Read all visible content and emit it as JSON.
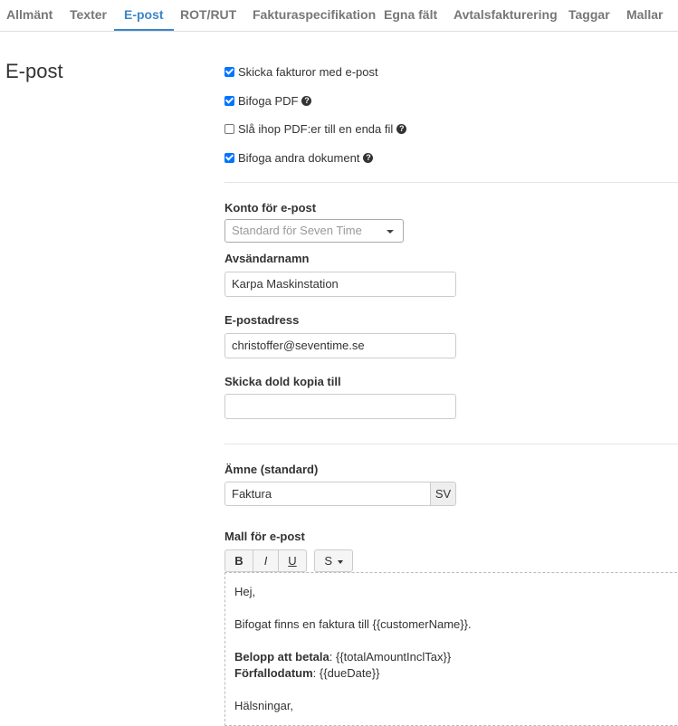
{
  "tabs": [
    {
      "label": "Allmänt",
      "active": false
    },
    {
      "label": "Texter",
      "active": false
    },
    {
      "label": "E-post",
      "active": true
    },
    {
      "label": "ROT/RUT",
      "active": false
    },
    {
      "label": "Fakturaspecifikation",
      "active": false
    },
    {
      "label": "Egna fält",
      "active": false
    },
    {
      "label": "Avtalsfakturering",
      "active": false
    },
    {
      "label": "Taggar",
      "active": false
    },
    {
      "label": "Mallar",
      "active": false
    }
  ],
  "section_title": "E-post",
  "checkboxes": [
    {
      "label": "Skicka fakturor med e-post",
      "checked": true,
      "help": false
    },
    {
      "label": "Bifoga PDF",
      "checked": true,
      "help": true
    },
    {
      "label": "Slå ihop PDF:er till en enda fil",
      "checked": false,
      "help": true
    },
    {
      "label": "Bifoga andra dokument",
      "checked": true,
      "help": true
    }
  ],
  "account": {
    "label": "Konto för e-post",
    "value": "Standard för Seven Time"
  },
  "sender_name": {
    "label": "Avsändarnamn",
    "value": "Karpa Maskinstation"
  },
  "email": {
    "label": "E-postadress",
    "value": "christoffer@seventime.se"
  },
  "bcc": {
    "label": "Skicka dold kopia till",
    "value": ""
  },
  "subject": {
    "label": "Ämne (standard)",
    "value": "Faktura",
    "lang": "SV"
  },
  "template": {
    "label": "Mall för e-post",
    "toolbar": {
      "bold": "B",
      "italic": "I",
      "underline": "U",
      "style": "S"
    },
    "greeting": "Hej,",
    "body": "Bifogat finns en faktura till {{customerName}}.",
    "amount_label": "Belopp att betala",
    "amount_value": ": {{totalAmountInclTax}}",
    "due_label": "Förfallodatum",
    "due_value": ": {{dueDate}}",
    "closing": "Hälsningar,"
  },
  "colors": {
    "accent": "#3a87c9",
    "checkbox": "#0075ff"
  }
}
